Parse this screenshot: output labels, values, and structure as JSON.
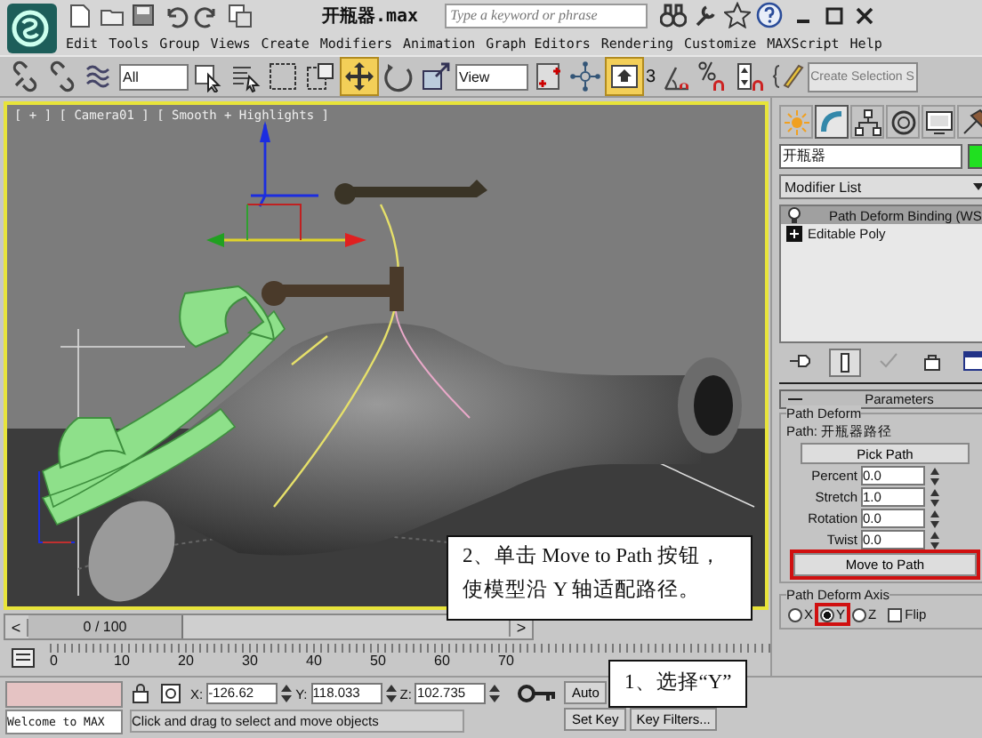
{
  "window": {
    "title": "开瓶器.max"
  },
  "search": {
    "placeholder": "Type a keyword or phrase"
  },
  "menu": [
    "Edit",
    "Tools",
    "Group",
    "Views",
    "Create",
    "Modifiers",
    "Animation",
    "Graph Editors",
    "Rendering",
    "Customize",
    "MAXScript",
    "Help"
  ],
  "toolbar": {
    "selection_filter": "All",
    "reference_coord": "View",
    "snap_label": "3",
    "named_selection": "Create Selection S"
  },
  "viewport": {
    "label": "[ + ] [ Camera01 ] [ Smooth + Highlights ]"
  },
  "command_panel": {
    "tabs": [
      {
        "selected": false
      },
      {
        "selected": true
      },
      {
        "selected": false
      },
      {
        "selected": false
      },
      {
        "selected": false
      },
      {
        "selected": false
      }
    ],
    "object_name": "开瓶器",
    "modifier_list": "Modifier List",
    "stack": [
      {
        "label": "Path Deform Binding (WS",
        "kind": "modifier",
        "selected": true
      },
      {
        "label": "Editable Poly",
        "kind": "base",
        "selected": false
      }
    ],
    "rollout": {
      "title": "Parameters",
      "group": "Path Deform",
      "path_label": "Path:",
      "path_name": "开瓶器路径",
      "pick_button": "Pick Path",
      "spinners": [
        {
          "label": "Percent",
          "value": "0.0"
        },
        {
          "label": "Stretch",
          "value": "1.0"
        },
        {
          "label": "Rotation",
          "value": "0.0"
        },
        {
          "label": "Twist",
          "value": "0.0"
        }
      ],
      "move_button": {
        "label": "Move to Path",
        "highlighted": true
      },
      "axis_group": "Path Deform Axis",
      "axes": [
        {
          "label": "X",
          "selected": false,
          "highlighted": false
        },
        {
          "label": "Y",
          "selected": true,
          "highlighted": true
        },
        {
          "label": "Z",
          "selected": false,
          "highlighted": false
        }
      ],
      "flip": {
        "label": "Flip",
        "checked": false
      }
    }
  },
  "timeline": {
    "prev": "<",
    "frame": "0 / 100",
    "next": ">",
    "ticks": [
      "0",
      "10",
      "20",
      "30",
      "40",
      "50",
      "60",
      "70"
    ]
  },
  "status": {
    "listener": "Welcome to MAX",
    "prompt": "Click and drag to select and move objects",
    "coords": [
      {
        "label": "X:",
        "value": "-126.62"
      },
      {
        "label": "Y:",
        "value": "118.033"
      },
      {
        "label": "Z:",
        "value": "102.735"
      }
    ],
    "auto_key": "Auto",
    "set_key": "Set Key",
    "key_filters": "Key Filters..."
  },
  "annotations": [
    "2、单击 Move to Path 按钮，使模型沿 Y 轴适配路径。",
    "1、选择“Y”"
  ]
}
